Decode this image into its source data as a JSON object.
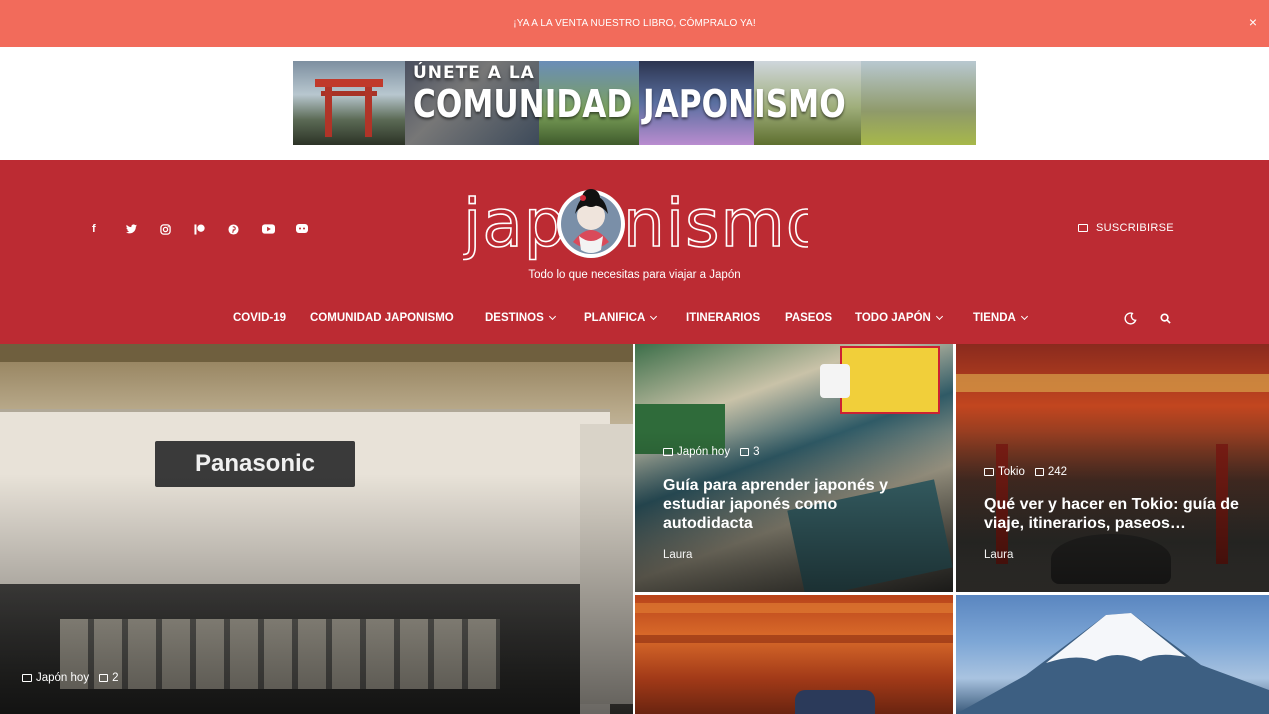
{
  "announcement": {
    "text": "¡YA A LA VENTA NUESTRO LIBRO, CÓMPRALO YA!",
    "close": "×"
  },
  "ad": {
    "line1": "ÚNETE A LA",
    "line2": "COMUNIDAD JAPONISMO"
  },
  "header": {
    "social": [
      "facebook-icon",
      "twitter-icon",
      "instagram-icon",
      "patreon-icon",
      "pinterest-icon",
      "youtube-icon",
      "discord-icon"
    ],
    "logo": "japonismo",
    "tagline": "Todo lo que necesitas para viajar a Japón",
    "subscribe": "SUSCRIBIRSE"
  },
  "nav": {
    "items": [
      {
        "label": "COVID-19"
      },
      {
        "label": "COMUNIDAD JAPONISMO"
      },
      {
        "label": "DESTINOS"
      },
      {
        "label": "PLANIFICA"
      },
      {
        "label": "ITINERARIOS"
      },
      {
        "label": "PASEOS"
      },
      {
        "label": "TODO JAPÓN"
      },
      {
        "label": "TIENDA"
      }
    ]
  },
  "colors": {
    "announce": "#f26b5b",
    "header": "#bc2b33"
  },
  "posts": [
    {
      "category": "Japón hoy",
      "comments": "2",
      "title": "",
      "author": ""
    },
    {
      "category": "Japón hoy",
      "comments": "3",
      "title": "Guía para aprender japonés y estudiar japonés como autodidacta",
      "author": "Laura"
    },
    {
      "category": "Tokio",
      "comments": "242",
      "title": "Qué ver y hacer en Tokio: guía de viaje, itinerarios, paseos…",
      "author": "Laura"
    }
  ]
}
